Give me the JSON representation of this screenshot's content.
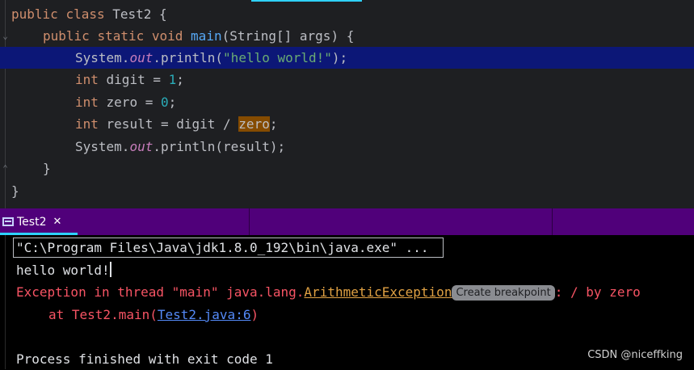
{
  "editor": {
    "lines": [
      {
        "kw1": "public",
        "kw2": "class",
        "rest": " Test2 {"
      },
      {
        "kw1": "public",
        "kw2": "static",
        "kw3": "void",
        "method": "main",
        "rest": "(String[] args) {"
      },
      {
        "obj": "System.",
        "field": "out",
        "call": ".println(",
        "str": "\"hello world!\"",
        "end": ");"
      },
      {
        "kw": "int",
        "mid": " digit = ",
        "num": "1",
        "end": ";"
      },
      {
        "kw": "int",
        "mid": " zero = ",
        "num": "0",
        "end": ";"
      },
      {
        "kw": "int",
        "mid": " result = digit / ",
        "warn": "zero",
        "end": ";"
      },
      {
        "obj": "System.",
        "field": "out",
        "call": ".println(result);"
      },
      {
        "text": "}"
      },
      {
        "text": "}"
      }
    ]
  },
  "run_tab": {
    "label": "Test2",
    "close": "✕",
    "icon": "run-console-icon"
  },
  "console": {
    "command": "\"C:\\Program Files\\Java\\jdk1.8.0_192\\bin\\java.exe\" ...",
    "output": "hello world!",
    "exception_prefix": "Exception in thread \"main\" java.lang.",
    "exception_class": "ArithmeticException",
    "breakpoint_badge": "Create breakpoint",
    "exception_suffix": ": / by zero",
    "stack_prefix": "at Test2.main(",
    "stack_link": "Test2.java:6",
    "stack_suffix": ")",
    "exit_message": "Process finished with exit code 1"
  },
  "watermark": "CSDN @niceffking"
}
